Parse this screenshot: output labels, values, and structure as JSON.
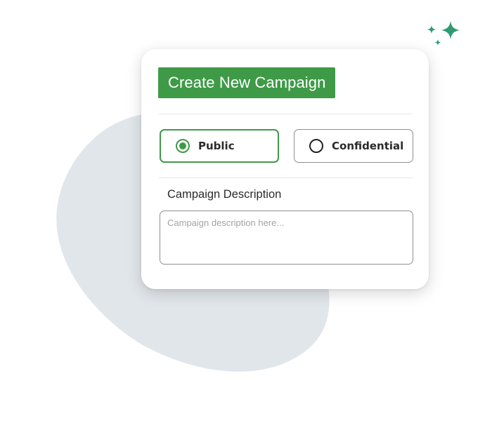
{
  "colors": {
    "accent": "#3f9a48",
    "sparkle": "#2f9a72",
    "blob": "#e1e6eb",
    "border": "#8f8f8f"
  },
  "campaign_form": {
    "title": "Create New Campaign",
    "visibility": {
      "selected": "Public",
      "options": [
        {
          "label": "Public",
          "selected": true
        },
        {
          "label": "Confidential",
          "selected": false
        }
      ]
    },
    "description": {
      "label": "Campaign Description",
      "placeholder": "Campaign description here...",
      "value": ""
    }
  },
  "decor": {
    "sparkle_icon": "sparkles-icon",
    "blob_shape": "background-blob"
  }
}
